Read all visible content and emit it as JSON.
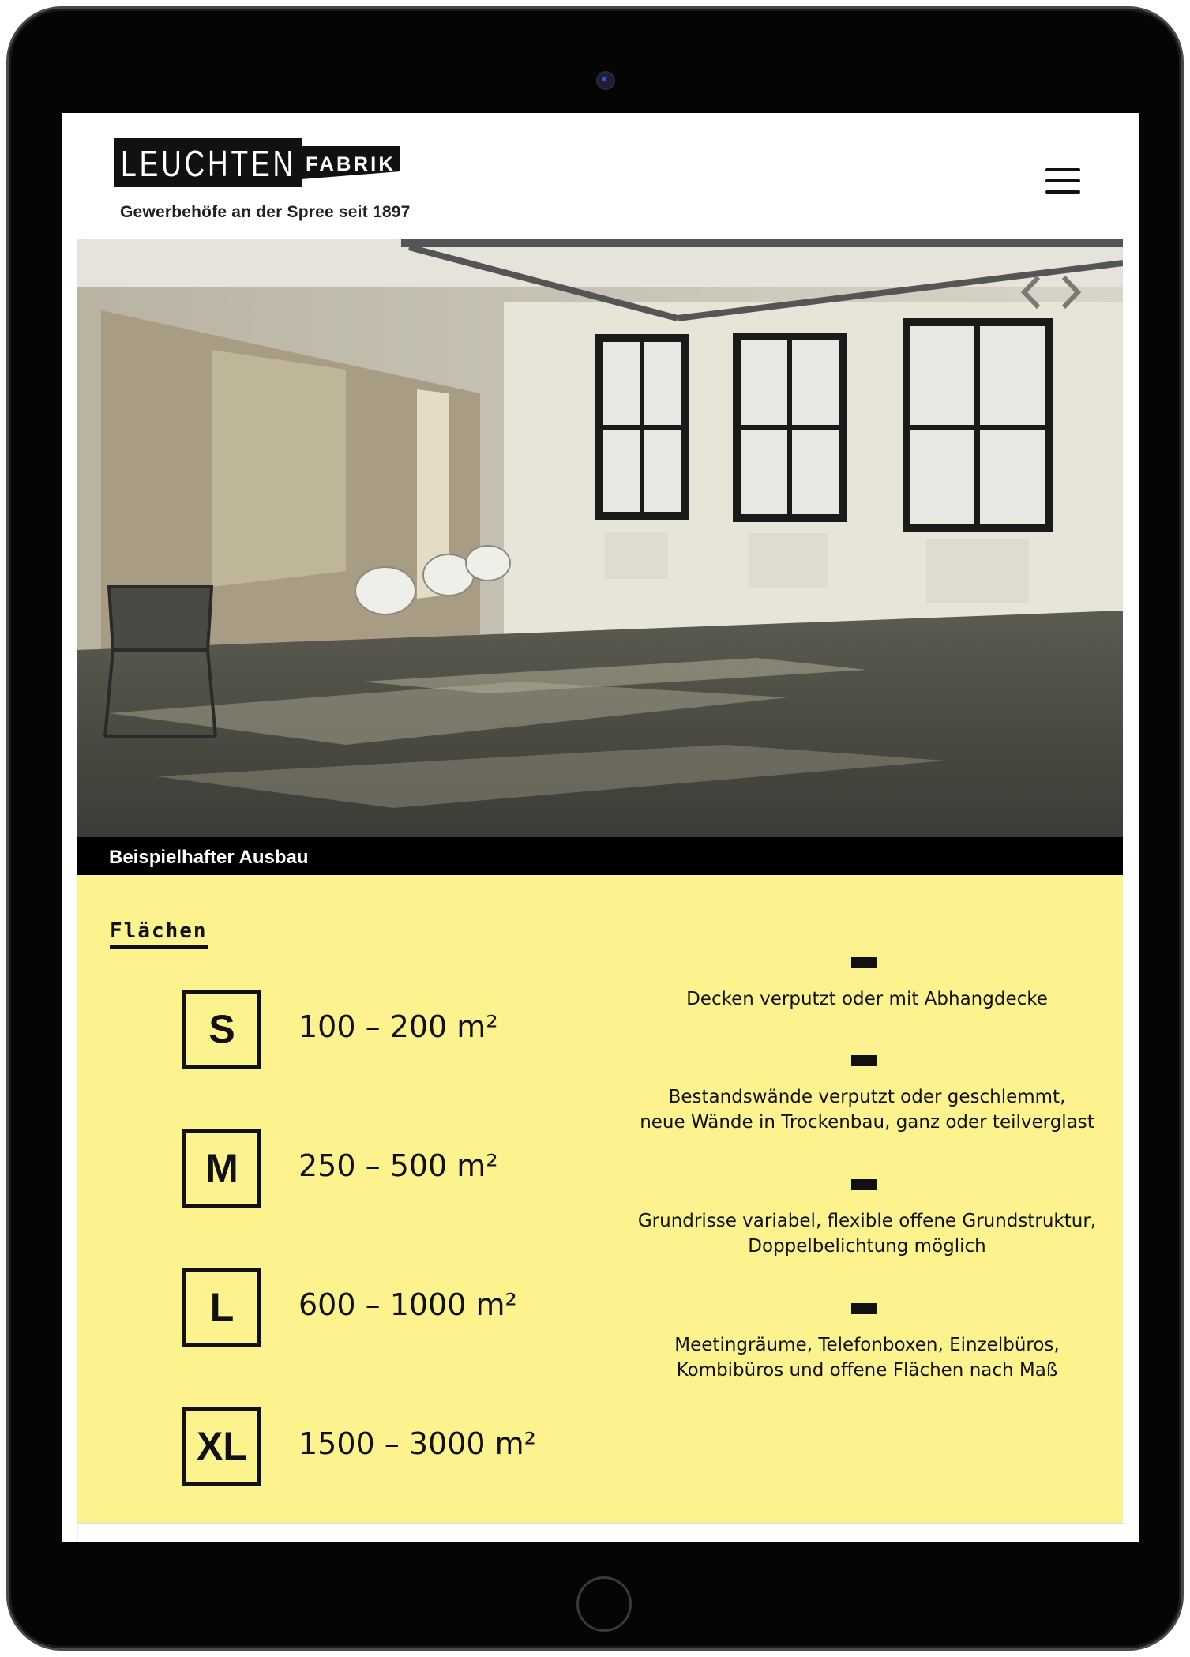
{
  "header": {
    "logo_text_main": "LEUCHTEN",
    "logo_text_sub": "FABRIK",
    "tagline": "Gewerbehöfe an der Spree seit 1897"
  },
  "hero": {
    "caption": "Beispielhafter Ausbau"
  },
  "section": {
    "title": "Flächen"
  },
  "sizes": [
    {
      "label": "S",
      "range": "100 – 200 m²"
    },
    {
      "label": "M",
      "range": "250 – 500 m²"
    },
    {
      "label": "L",
      "range": "600 – 1000 m²"
    },
    {
      "label": "XL",
      "range": "1500 – 3000 m²"
    }
  ],
  "features": [
    {
      "line1": "Decken verputzt oder mit Abhangdecke",
      "line2": ""
    },
    {
      "line1": "Bestandswände verputzt oder geschlemmt,",
      "line2": "neue Wände in Trockenbau, ganz oder teilverglast"
    },
    {
      "line1": "Grundrisse variabel, flexible offene Grundstruktur,",
      "line2": "Doppelbelichtung möglich"
    },
    {
      "line1": "Meetingräume, Telefonboxen, Einzelbüros,",
      "line2": "Kombibüros und offene Flächen nach Maß"
    }
  ],
  "colors": {
    "accent_yellow": "#fcf38f",
    "text": "#111111",
    "device_frame": "#050505"
  },
  "icons": {
    "menu": "hamburger-icon",
    "prev": "chevron-left-icon",
    "next": "chevron-right-icon"
  }
}
